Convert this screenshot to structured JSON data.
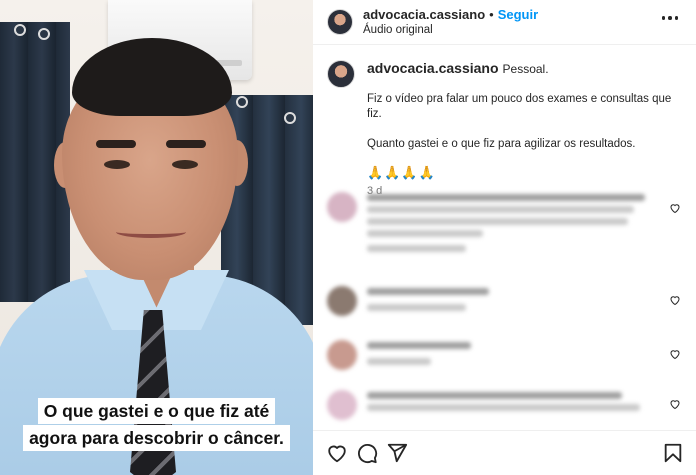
{
  "header": {
    "username": "advocacia.cassiano",
    "separator": "•",
    "follow_label": "Seguir",
    "audio": "Áudio original"
  },
  "post": {
    "username": "advocacia.cassiano",
    "category": "Pessoal.",
    "line1": "Fiz o vídeo pra falar um pouco dos exames e consultas que fiz.",
    "line2": "Quanto gastei e o que fiz para agilizar os resultados.",
    "emojis": "🙏🙏🙏🙏",
    "age": "3 d"
  },
  "video": {
    "caption_line1": "O que gastei e o que fiz até",
    "caption_line2": "agora para descobrir o câncer."
  },
  "icons": {
    "more": "more-options-icon",
    "like": "heart-icon",
    "comment": "comment-icon",
    "share": "share-icon",
    "save": "bookmark-icon"
  },
  "colors": {
    "follow": "#0095f6",
    "text": "#262626",
    "muted": "#737373"
  }
}
